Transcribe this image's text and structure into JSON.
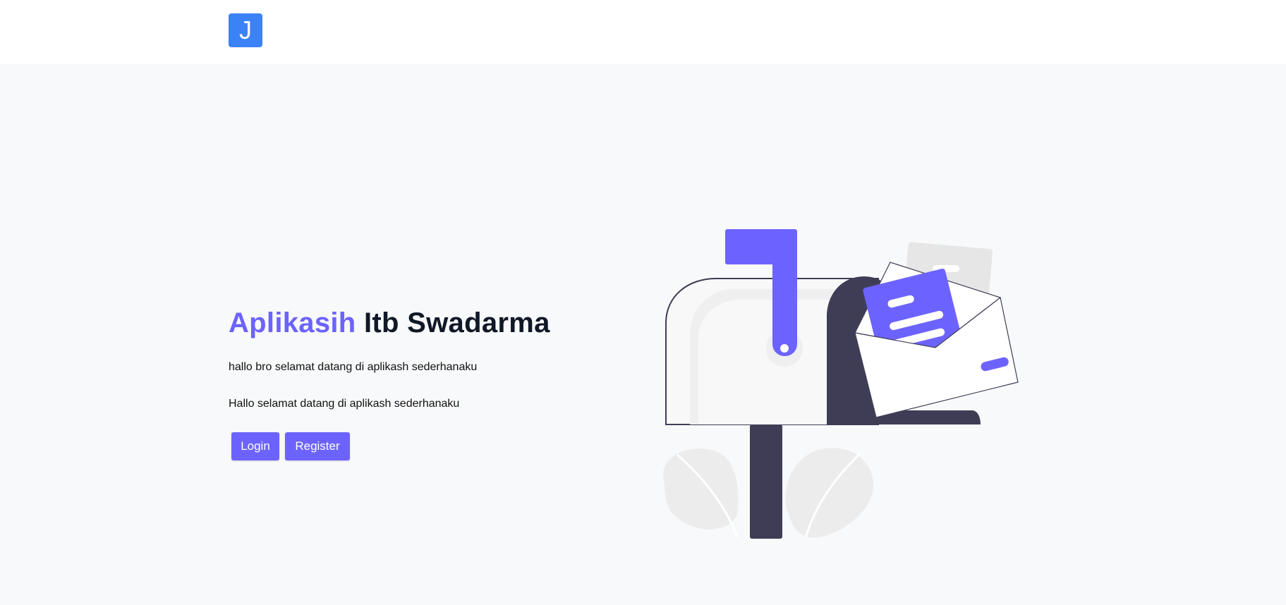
{
  "header": {
    "logo_letter": "J"
  },
  "hero": {
    "title_accent": "Aplikasih",
    "title_rest": "Itb Swadarma",
    "line1": "hallo bro selamat datang di aplikash sederhanaku",
    "line2": "Hallo selamat datang di aplikash sederhanaku"
  },
  "actions": {
    "login_label": "Login",
    "register_label": "Register"
  },
  "illustration": {
    "icon": "mailbox-illustration"
  },
  "colors": {
    "accent": "#6c63ff",
    "logo_bg": "#3b82f6",
    "dark": "#3f3d56",
    "background": "#f8f9fa"
  }
}
